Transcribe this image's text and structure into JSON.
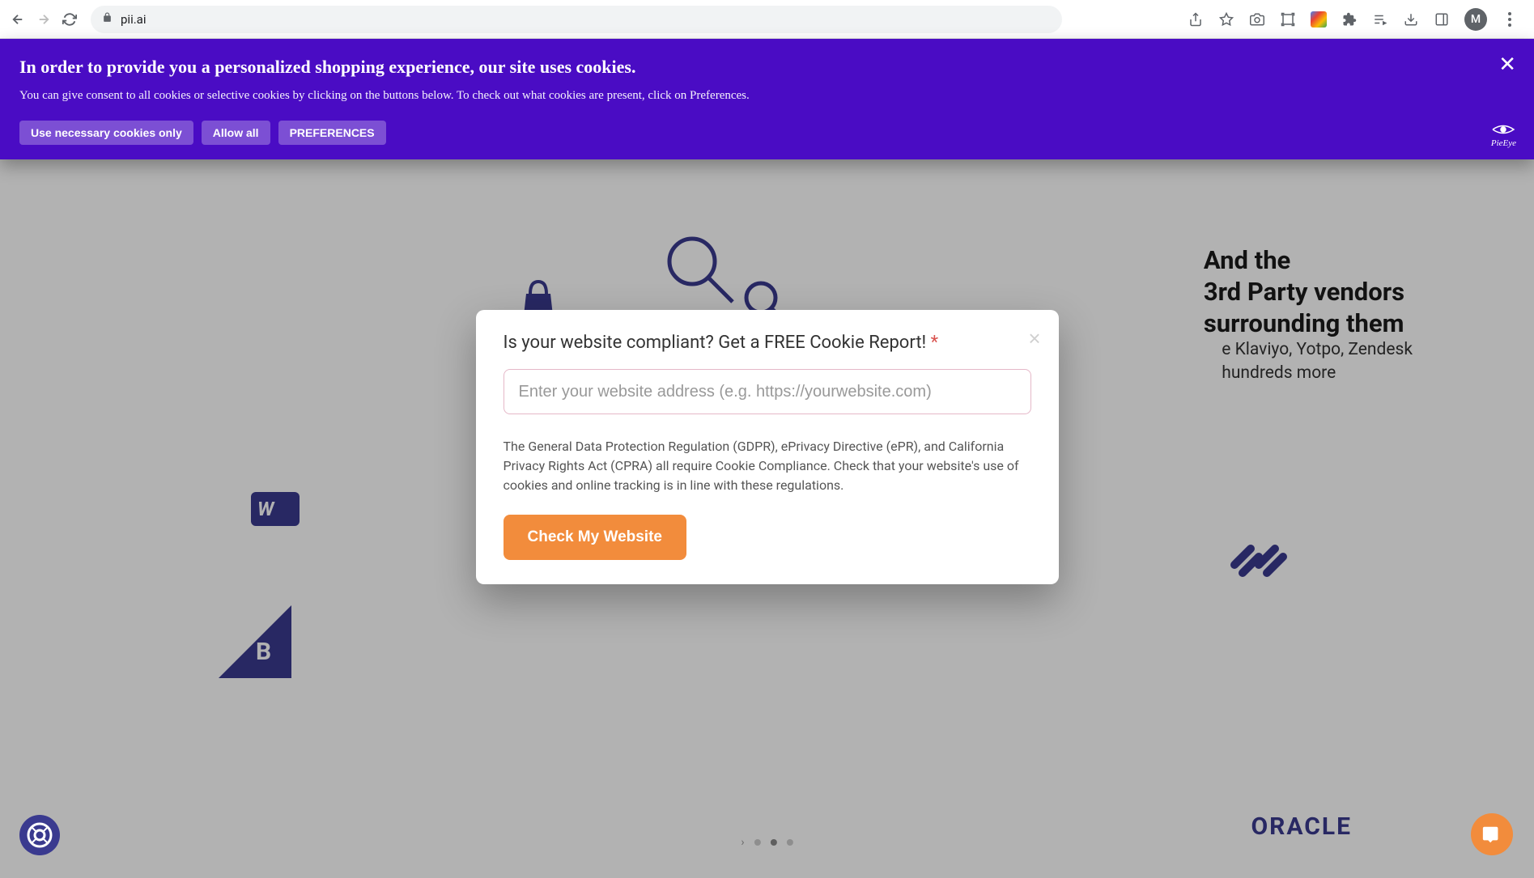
{
  "browser": {
    "url": "pii.ai",
    "avatar_letter": "M"
  },
  "cookie_banner": {
    "title": "In order to provide you a personalized shopping experience, our site uses cookies.",
    "text": "You can give consent to all cookies or selective cookies by clicking on the buttons below. To check out what cookies are present, click on Preferences.",
    "btn_necessary": "Use necessary cookies only",
    "btn_allow": "Allow all",
    "btn_prefs": "PREFERENCES",
    "logo": "PieEye"
  },
  "background": {
    "vendors_l1": "And the",
    "vendors_l2": "3rd Party vendors",
    "vendors_l3": "surrounding them",
    "vendors_sub_l1": "e Klaviyo, Yotpo, Zendesk",
    "vendors_sub_l2": "hundreds more",
    "woo": "W",
    "bc": "B",
    "oracle": "ORACLE"
  },
  "modal": {
    "title": "Is your website compliant? Get a FREE Cookie Report! ",
    "required": "*",
    "placeholder": "Enter your website address (e.g. https://yourwebsite.com)",
    "desc": "The General Data Protection Regulation (GDPR), ePrivacy Directive (ePR), and California Privacy Rights Act (CPRA) all require Cookie Compliance. Check that your website's use of cookies and online tracking is in line with these regulations.",
    "submit": "Check My Website"
  }
}
